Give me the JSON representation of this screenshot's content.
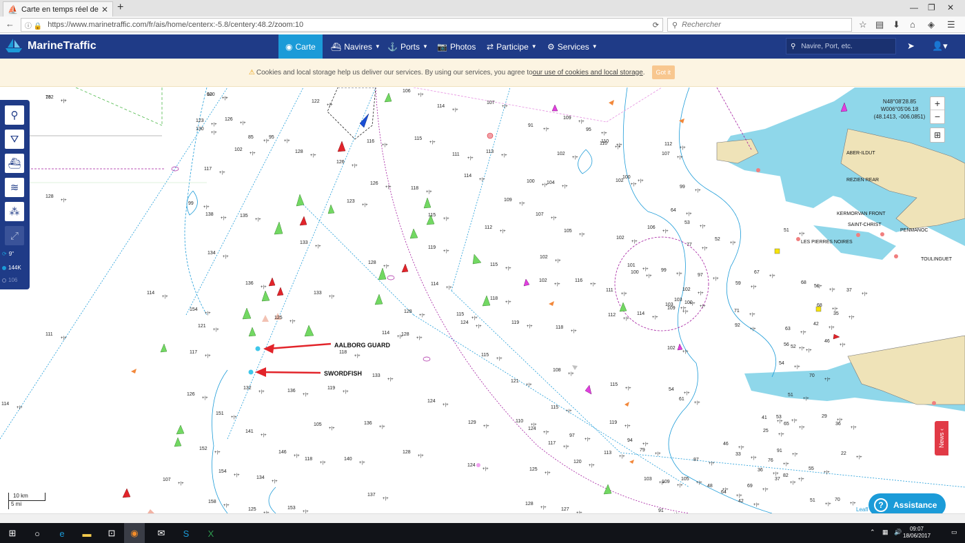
{
  "browser": {
    "tab_title": "Carte en temps réel des navi",
    "url": "https://www.marinetraffic.com/fr/ais/home/centerx:-5.8/centery:48.2/zoom:10",
    "search_placeholder": "Rechercher"
  },
  "header": {
    "brand": "MarineTraffic",
    "nav": {
      "carte": "Carte",
      "navires": "Navires",
      "ports": "Ports",
      "photos": "Photos",
      "participe": "Participe",
      "services": "Services"
    },
    "search_placeholder": "Navire, Port, etc."
  },
  "cookie": {
    "text": "Cookies and local storage help us deliver our services. By using our services, you agree to",
    "link": "our use of cookies and local storage",
    "end": ".",
    "button": "Got it"
  },
  "toolbar": {
    "refresh": "9\"",
    "vessels": "144K",
    "other": "106"
  },
  "map": {
    "coords": {
      "lat": "N48°08'28.85",
      "lon": "W006°05'06.18",
      "dec": "(48.1413, -006.0851)"
    },
    "scale_km": "10 km",
    "scale_mi": "5 mi",
    "attribution": "Leafl",
    "ships": {
      "aalborg": "AALBORG GUARD",
      "swordfish": "SWORDFISH"
    },
    "places": [
      "ABER-ILDUT",
      "REZIEN REAR",
      "KERMORVAN FRONT",
      "SAINT-CHRIST",
      "PENMANOC",
      "LES PIERRES NOIRES",
      "TOULINGUET"
    ],
    "depths": [
      {
        "v": "162"
      },
      {
        "v": "120"
      },
      {
        "v": "123"
      },
      {
        "v": "126"
      },
      {
        "v": "130"
      },
      {
        "v": "102"
      },
      {
        "v": "85"
      },
      {
        "v": "95"
      },
      {
        "v": "122"
      },
      {
        "v": "128"
      },
      {
        "v": "126"
      },
      {
        "v": "117"
      },
      {
        "v": "128"
      },
      {
        "v": "99"
      },
      {
        "v": "138"
      },
      {
        "v": "135"
      },
      {
        "v": "123"
      },
      {
        "v": "133"
      },
      {
        "v": "134"
      },
      {
        "v": "114"
      },
      {
        "v": "136"
      },
      {
        "v": "133"
      },
      {
        "v": "154"
      },
      {
        "v": "121"
      },
      {
        "v": "125"
      },
      {
        "v": "111"
      },
      {
        "v": "117"
      },
      {
        "v": "118"
      },
      {
        "v": "133"
      },
      {
        "v": "132"
      },
      {
        "v": "136"
      },
      {
        "v": "119"
      },
      {
        "v": "126"
      },
      {
        "v": "151"
      },
      {
        "v": "141"
      },
      {
        "v": "105"
      },
      {
        "v": "152"
      },
      {
        "v": "146"
      },
      {
        "v": "118"
      },
      {
        "v": "140"
      },
      {
        "v": "154"
      },
      {
        "v": "134"
      },
      {
        "v": "107"
      },
      {
        "v": "137"
      },
      {
        "v": "158"
      },
      {
        "v": "125"
      },
      {
        "v": "153"
      },
      {
        "v": "114"
      },
      {
        "v": "106"
      },
      {
        "v": "114"
      },
      {
        "v": "116"
      },
      {
        "v": "115"
      },
      {
        "v": "111"
      },
      {
        "v": "114"
      },
      {
        "v": "118"
      },
      {
        "v": "126"
      },
      {
        "v": "115"
      },
      {
        "v": "119"
      },
      {
        "v": "128"
      },
      {
        "v": "114"
      },
      {
        "v": "128"
      },
      {
        "v": "114"
      },
      {
        "v": "115"
      },
      {
        "v": "124"
      },
      {
        "v": "115"
      },
      {
        "v": "128"
      },
      {
        "v": "121"
      },
      {
        "v": "124"
      },
      {
        "v": "129"
      },
      {
        "v": "136"
      },
      {
        "v": "128"
      },
      {
        "v": "124"
      },
      {
        "v": "125"
      },
      {
        "v": "128"
      },
      {
        "v": "127"
      },
      {
        "v": "107"
      },
      {
        "v": "91"
      },
      {
        "v": "113"
      },
      {
        "v": "112"
      },
      {
        "v": "115"
      },
      {
        "v": "118"
      },
      {
        "v": "119"
      },
      {
        "v": "118"
      },
      {
        "v": "108"
      },
      {
        "v": "115"
      },
      {
        "v": "110"
      },
      {
        "v": "124"
      },
      {
        "v": "117"
      },
      {
        "v": "97"
      },
      {
        "v": "120"
      },
      {
        "v": "113"
      },
      {
        "v": "109"
      },
      {
        "v": "95"
      },
      {
        "v": "110"
      },
      {
        "v": "102"
      },
      {
        "v": "102"
      },
      {
        "v": "100"
      },
      {
        "v": "104"
      },
      {
        "v": "109"
      },
      {
        "v": "107"
      },
      {
        "v": "102"
      },
      {
        "v": "105"
      },
      {
        "v": "102"
      },
      {
        "v": "116"
      },
      {
        "v": "111"
      },
      {
        "v": "112"
      },
      {
        "v": "115"
      },
      {
        "v": "119"
      },
      {
        "v": "110"
      },
      {
        "v": "103"
      },
      {
        "v": "100"
      },
      {
        "v": "101"
      },
      {
        "v": "102"
      },
      {
        "v": "106"
      },
      {
        "v": "100"
      },
      {
        "v": "99"
      },
      {
        "v": "102"
      },
      {
        "v": "103"
      },
      {
        "v": "103"
      },
      {
        "v": "100"
      },
      {
        "v": "109"
      },
      {
        "v": "97"
      },
      {
        "v": "114"
      },
      {
        "v": "102"
      },
      {
        "v": "54"
      },
      {
        "v": "61"
      },
      {
        "v": "87"
      },
      {
        "v": "94"
      },
      {
        "v": "79"
      },
      {
        "v": "105"
      },
      {
        "v": "91"
      },
      {
        "v": "109"
      },
      {
        "v": "107"
      },
      {
        "v": "112"
      },
      {
        "v": "99"
      },
      {
        "v": "64"
      },
      {
        "v": "53"
      },
      {
        "v": "77"
      },
      {
        "v": "52"
      },
      {
        "v": "59"
      },
      {
        "v": "51"
      },
      {
        "v": "67"
      },
      {
        "v": "71"
      },
      {
        "v": "63"
      },
      {
        "v": "92"
      },
      {
        "v": "68"
      },
      {
        "v": "51"
      },
      {
        "v": "68"
      },
      {
        "v": "35"
      },
      {
        "v": "37"
      },
      {
        "v": "42"
      },
      {
        "v": "46"
      },
      {
        "v": "54"
      },
      {
        "v": "56"
      },
      {
        "v": "51"
      },
      {
        "v": "52"
      },
      {
        "v": "70"
      },
      {
        "v": "48"
      },
      {
        "v": "64"
      },
      {
        "v": "42"
      },
      {
        "v": "69"
      },
      {
        "v": "91"
      },
      {
        "v": "82"
      },
      {
        "v": "76"
      },
      {
        "v": "55"
      },
      {
        "v": "65"
      },
      {
        "v": "53"
      },
      {
        "v": "41"
      },
      {
        "v": "37"
      },
      {
        "v": "46"
      },
      {
        "v": "33"
      },
      {
        "v": "36"
      },
      {
        "v": "25"
      },
      {
        "v": "29"
      },
      {
        "v": "22"
      },
      {
        "v": "36"
      },
      {
        "v": "51"
      },
      {
        "v": "70"
      },
      {
        "v": "73"
      },
      {
        "v": "60"
      }
    ]
  },
  "taskbar": {
    "time": "09:07",
    "date": "18/06/2017"
  }
}
